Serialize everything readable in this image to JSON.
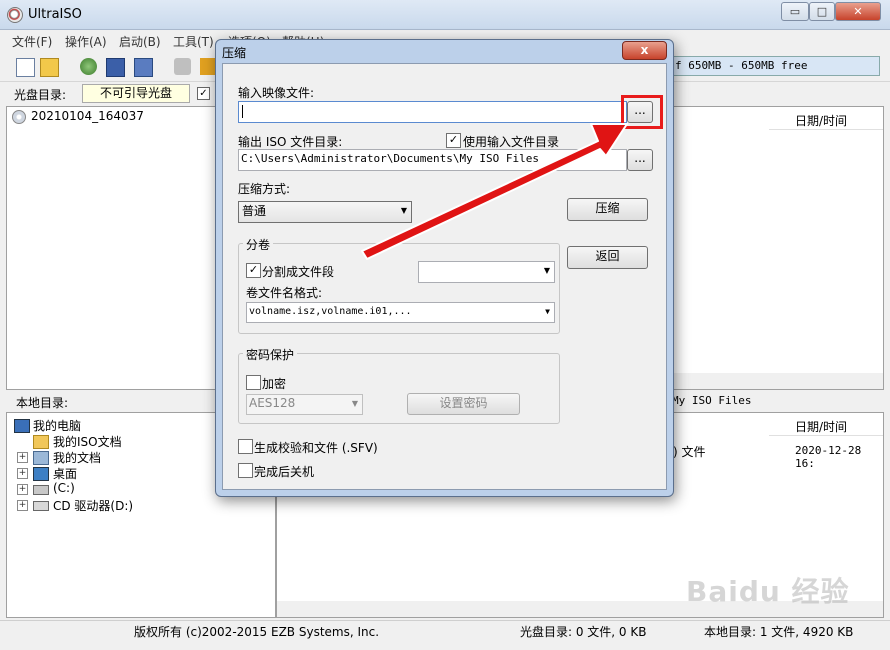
{
  "window": {
    "title": "UltraISO",
    "min": "▭",
    "max": "□",
    "close": "✕"
  },
  "menu": [
    "文件(F)",
    "操作(A)",
    "启动(B)",
    "工具(T)",
    "选项(O)",
    "帮助(H)"
  ],
  "size_indicator": "f 650MB - 650MB free",
  "cd_row": {
    "label": "光盘目录:",
    "disc_name": "不可引导光盘",
    "check": "✓"
  },
  "cd_tree": {
    "item": "20210104_164037"
  },
  "right_top": {
    "col_datetime": "日期/时间"
  },
  "local_bar": {
    "label": "本地目录:",
    "path_fragment": "My ISO Files"
  },
  "local_tree": [
    {
      "label": "我的电脑",
      "icon": "computer-icon"
    },
    {
      "label": "我的ISO文档",
      "icon": "folder-icon"
    },
    {
      "label": "我的文档",
      "icon": "folder-icon"
    },
    {
      "label": "桌面",
      "icon": "desktop-icon"
    },
    {
      "label": "(C:)",
      "icon": "drive-icon"
    },
    {
      "label": "CD 驱动器(D:)",
      "icon": "cd-drive-icon"
    }
  ],
  "right_bottom": {
    "col_datetime": "日期/时间",
    "file_suffix": ") 文件",
    "file_date": "2020-12-28 16:"
  },
  "status": {
    "copyright": "版权所有 (c)2002-2015 EZB Systems, Inc.",
    "cd_info": "光盘目录: 0 文件, 0 KB",
    "local_info": "本地目录: 1 文件, 4920 KB"
  },
  "dialog": {
    "title": "压缩",
    "close": "x",
    "input_label": "输入映像文件:",
    "input_value": "",
    "browse": "...",
    "output_label": "输出 ISO 文件目录:",
    "use_input_dir": "使用输入文件目录",
    "use_input_dir_checked": "✓",
    "output_value": "C:\\Users\\Administrator\\Documents\\My ISO Files",
    "method_label": "压缩方式:",
    "method_value": "普通",
    "compress_button": "压缩",
    "back_button": "返回",
    "split_group": "分卷",
    "split_label": "分割成文件段",
    "split_checked": "✓",
    "split_size": "",
    "vol_format_label": "卷文件名格式:",
    "vol_format_value": "volname.isz,volname.i01,...",
    "password_group": "密码保护",
    "encrypt_label": "加密",
    "encrypt_algo": "AES128",
    "set_password_button": "设置密码",
    "sfv_label": "生成校验和文件 (.SFV)",
    "shutdown_label": "完成后关机"
  },
  "colors": {
    "highlight": "#e81b1b",
    "arrow": "#e01414",
    "dialog_frame": "#bcd0ea"
  },
  "watermark": "Baidu 经验"
}
